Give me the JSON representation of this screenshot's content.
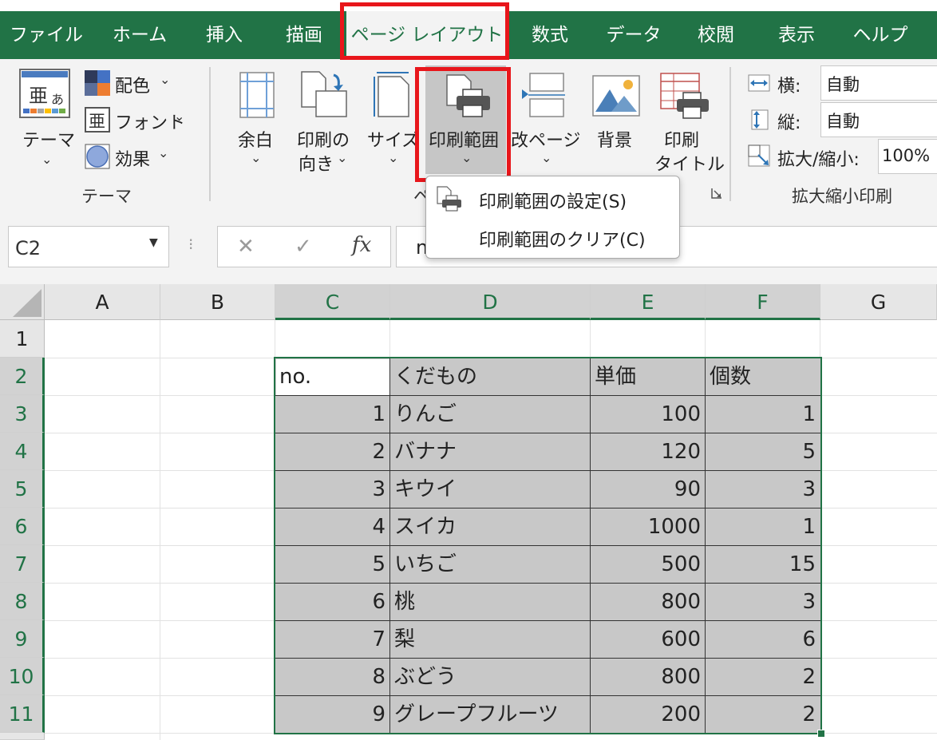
{
  "menubar": {
    "tabs": [
      "ファイル",
      "ホーム",
      "挿入",
      "描画",
      "ページ レイアウト",
      "数式",
      "データ",
      "校閲",
      "表示",
      "ヘルプ"
    ],
    "active_tab": "ページ レイアウト"
  },
  "ribbon": {
    "theme_button": "テーマ",
    "colors": "配色",
    "fonts": "フォント",
    "effects": "効果",
    "theme_group_label": "テーマ",
    "margins": "余白",
    "orientation_line1": "印刷の",
    "orientation_line2": "向き",
    "size": "サイズ",
    "print_area": "印刷範囲",
    "breaks": "改ページ",
    "background": "背景",
    "print_titles_line1": "印刷",
    "print_titles_line2": "タイトル",
    "page_setup_label_fragment": "ペ",
    "width_label": "横:",
    "width_value": "自動",
    "height_label": "縦:",
    "height_value": "自動",
    "scale_label": "拡大/縮小:",
    "scale_value": "100%",
    "scale_group_label": "拡大縮小印刷"
  },
  "dropdown": {
    "set_print_area": "印刷範囲の設定(S)",
    "clear_print_area": "印刷範囲のクリア(C)"
  },
  "formula_bar": {
    "name_box": "C2",
    "cancel": "✕",
    "enter": "✓",
    "fx": "fx",
    "content": "n"
  },
  "sheet": {
    "columns": [
      "A",
      "B",
      "C",
      "D",
      "E",
      "F",
      "G"
    ],
    "rows": [
      "1",
      "2",
      "3",
      "4",
      "5",
      "6",
      "7",
      "8",
      "9",
      "10",
      "11"
    ],
    "header": [
      "no.",
      "くだもの",
      "単価",
      "個数"
    ],
    "data": [
      [
        "1",
        "りんご",
        "100",
        "1"
      ],
      [
        "2",
        "バナナ",
        "120",
        "5"
      ],
      [
        "3",
        "キウイ",
        "90",
        "3"
      ],
      [
        "4",
        "スイカ",
        "1000",
        "1"
      ],
      [
        "5",
        "いちご",
        "500",
        "15"
      ],
      [
        "6",
        "桃",
        "800",
        "3"
      ],
      [
        "7",
        "梨",
        "600",
        "6"
      ],
      [
        "8",
        "ぶどう",
        "800",
        "2"
      ],
      [
        "9",
        "グレープフルーツ",
        "200",
        "2"
      ]
    ]
  },
  "colors": {
    "excel_green": "#217346",
    "highlight_red": "#e8161b",
    "print_area_fill": "#c8c8c8"
  }
}
